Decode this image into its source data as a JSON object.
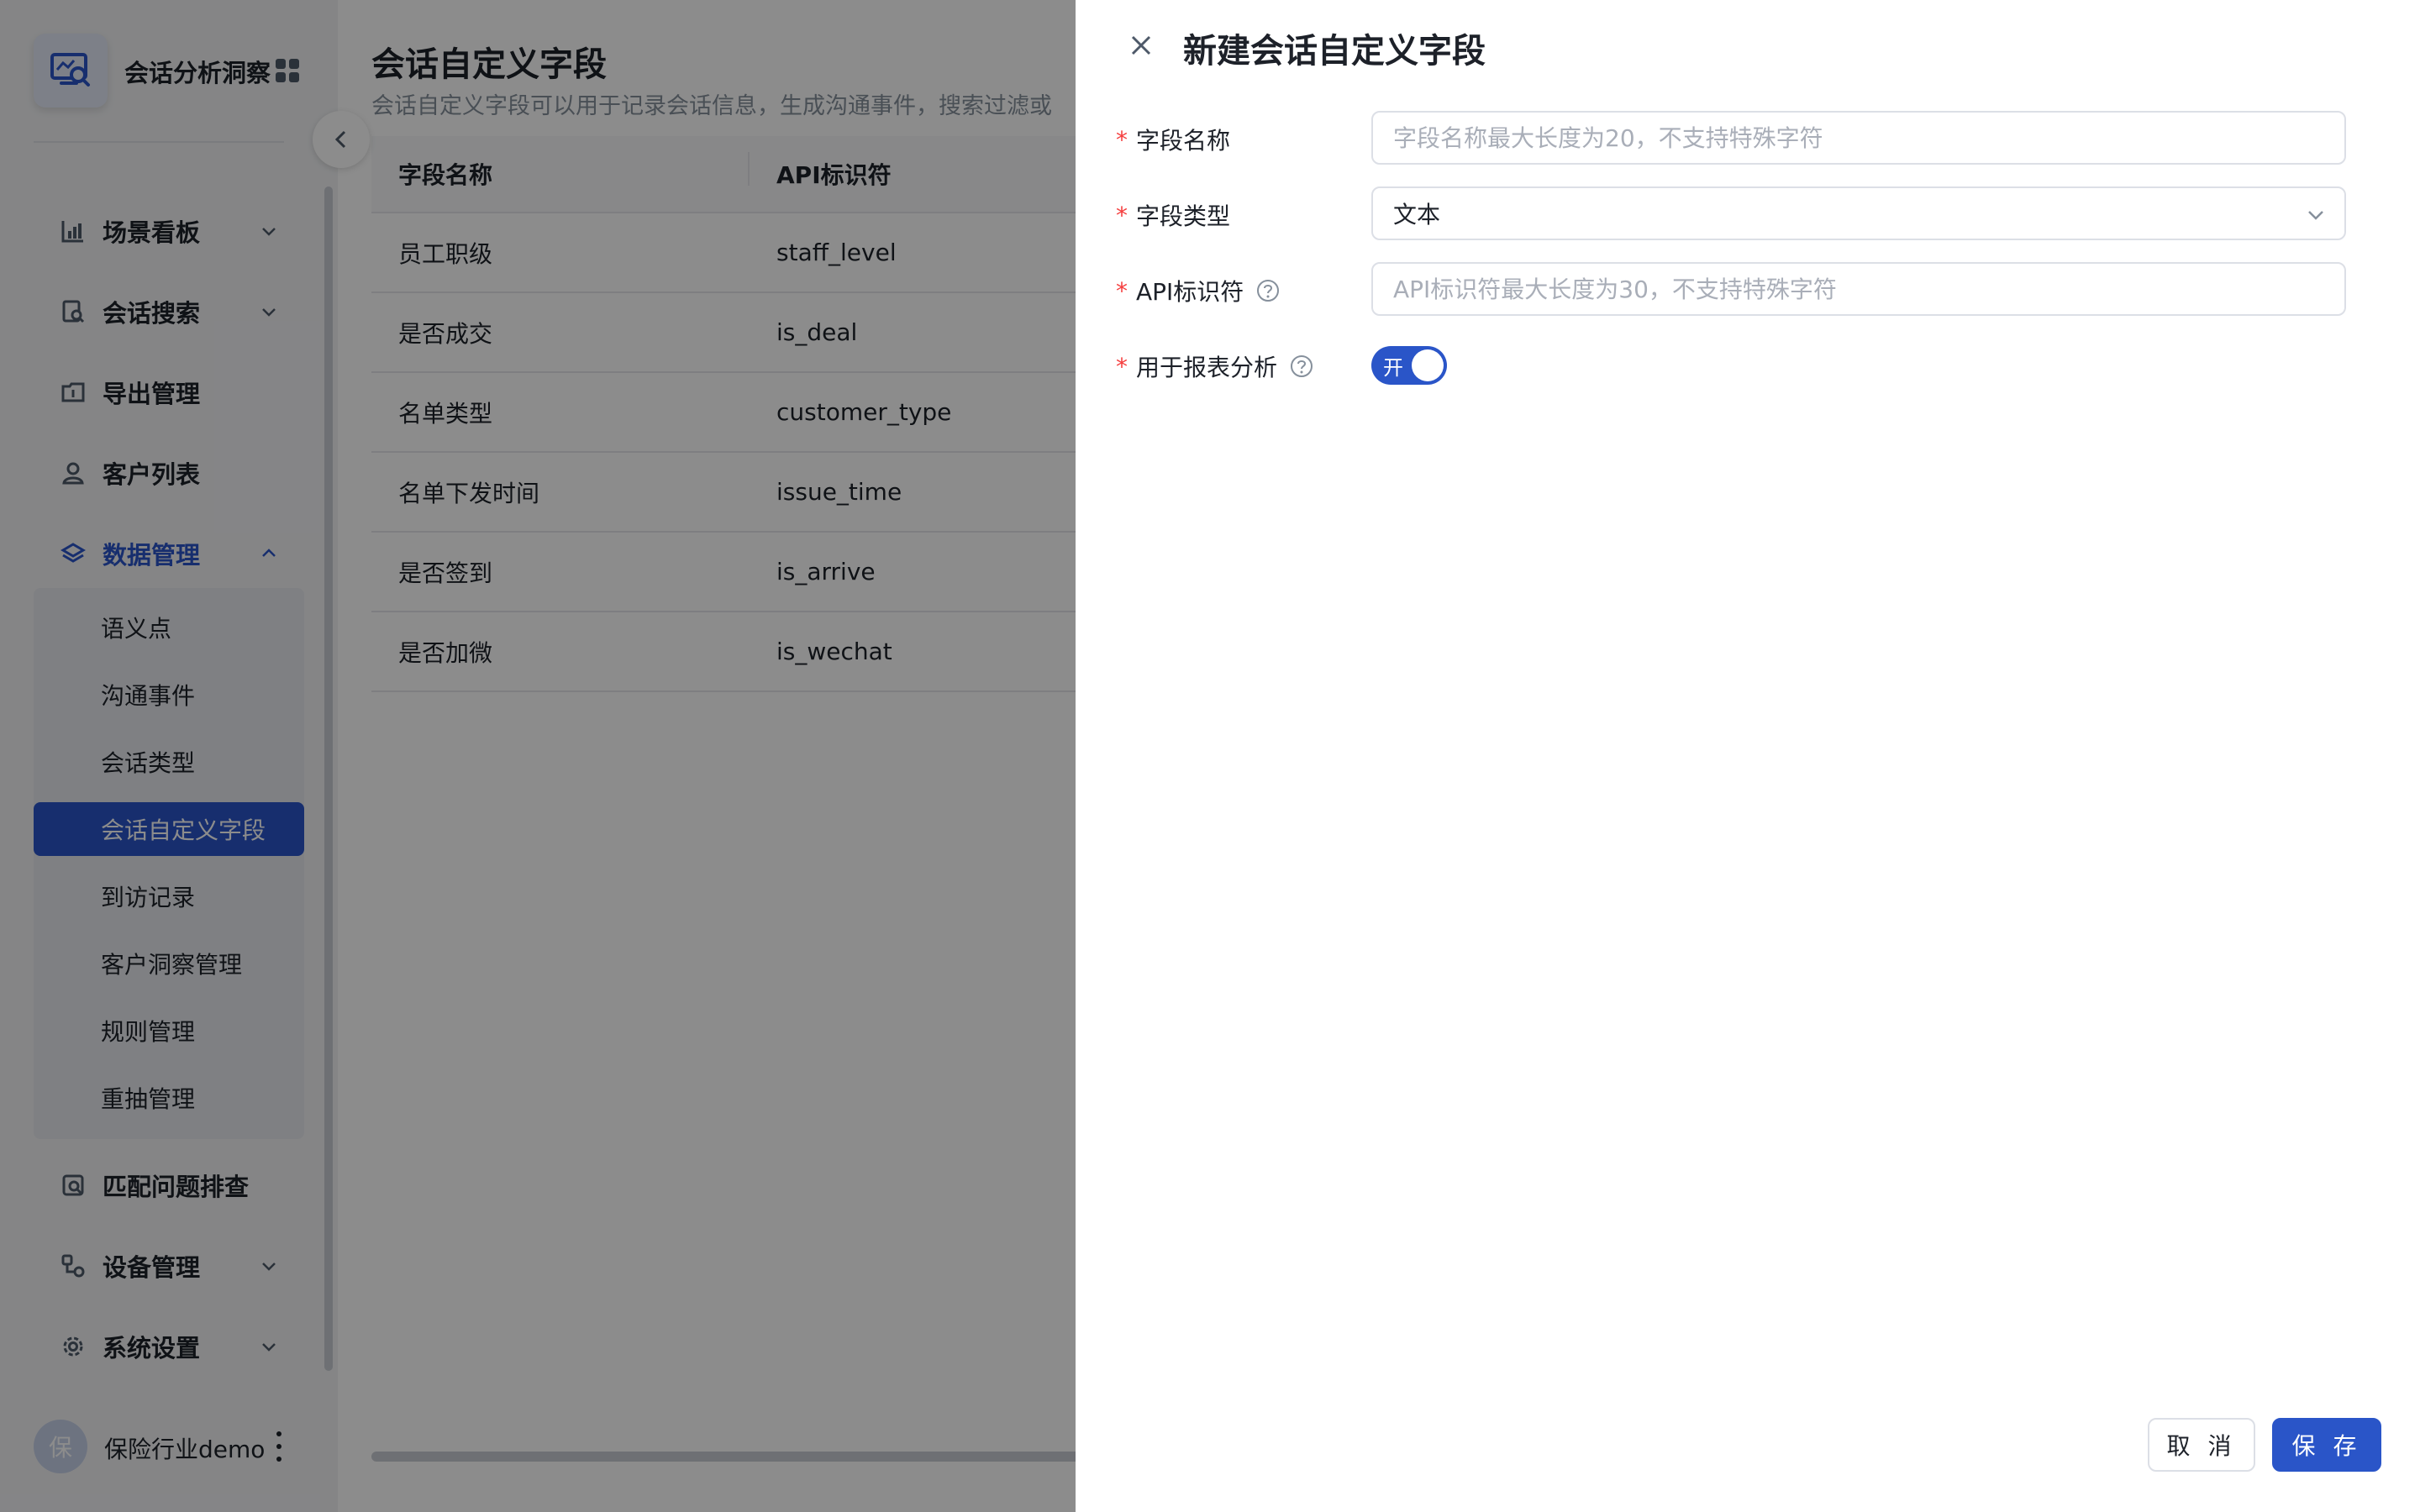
{
  "app": {
    "title": "会话分析洞察",
    "avatar_char": "保",
    "user_name": "保险行业demo"
  },
  "sidebar": {
    "menu": [
      {
        "label": "场景看板",
        "icon": "chart-icon",
        "has_arrow": true
      },
      {
        "label": "会话搜索",
        "icon": "search-doc-icon",
        "has_arrow": true
      },
      {
        "label": "导出管理",
        "icon": "export-icon",
        "has_arrow": false
      },
      {
        "label": "客户列表",
        "icon": "user-icon",
        "has_arrow": false
      },
      {
        "label": "数据管理",
        "icon": "layers-icon",
        "has_arrow": true,
        "expanded": true
      },
      {
        "label": "匹配问题排查",
        "icon": "inspect-icon",
        "has_arrow": false
      },
      {
        "label": "设备管理",
        "icon": "device-icon",
        "has_arrow": true
      },
      {
        "label": "系统设置",
        "icon": "gear-icon",
        "has_arrow": true
      }
    ],
    "data_management_children": [
      {
        "label": "语义点"
      },
      {
        "label": "沟通事件"
      },
      {
        "label": "会话类型"
      },
      {
        "label": "会话自定义字段",
        "selected": true
      },
      {
        "label": "到访记录"
      },
      {
        "label": "客户洞察管理"
      },
      {
        "label": "规则管理"
      },
      {
        "label": "重抽管理"
      }
    ]
  },
  "main": {
    "title": "会话自定义字段",
    "description": "会话自定义字段可以用于记录会话信息，生成沟通事件，搜索过滤或",
    "table": {
      "headers": [
        "字段名称",
        "API标识符"
      ],
      "rows": [
        [
          "员工职级",
          "staff_level"
        ],
        [
          "是否成交",
          "is_deal"
        ],
        [
          "名单类型",
          "customer_type"
        ],
        [
          "名单下发时间",
          "issue_time"
        ],
        [
          "是否签到",
          "is_arrive"
        ],
        [
          "是否加微",
          "is_wechat"
        ]
      ]
    }
  },
  "drawer": {
    "title": "新建会话自定义字段",
    "fields": {
      "name": {
        "label": "字段名称",
        "required_mark": "*",
        "placeholder": "字段名称最大长度为20，不支持特殊字符",
        "value": ""
      },
      "type": {
        "label": "字段类型",
        "required_mark": "*",
        "value": "文本"
      },
      "api": {
        "label": "API标识符",
        "required_mark": "*",
        "placeholder": "API标识符最大长度为30，不支持特殊字符",
        "value": ""
      },
      "report": {
        "label": "用于报表分析",
        "required_mark": "*",
        "switch_text": "开",
        "on": true
      }
    },
    "buttons": {
      "cancel": "取 消",
      "save": "保 存"
    }
  },
  "colors": {
    "primary": "#2a55c8",
    "required": "#f53f3f",
    "overlay": "rgba(0,0,0,0.45)"
  }
}
